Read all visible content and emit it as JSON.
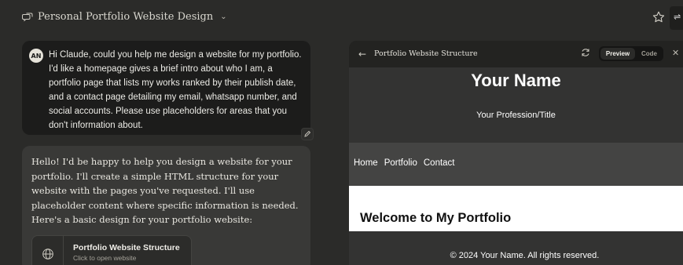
{
  "header": {
    "conversation_title": "Personal Portfolio Website Design",
    "icons": {
      "chat": "chat-bubbles-icon",
      "dropdown": "chevron-down-icon",
      "star": "star-icon",
      "settings": "sliders-icon"
    }
  },
  "user_message": {
    "avatar_initials": "AN",
    "text": "Hi Claude, could you help me design a website for my portfolio. I'd like a homepage gives a brief intro about who I am, a portfolio page that lists my works ranked by their publish date, and a contact page detailing my email, whatsapp number, and social accounts. Please use placeholders for areas that you don't information about."
  },
  "assistant_message": {
    "text": "Hello! I'd be happy to help you design a website for your portfolio. I'll create a simple HTML structure for your website with the pages you've requested. I'll use placeholder content where specific information is needed. Here's a basic design for your portfolio website:",
    "artifact": {
      "title": "Portfolio Website Structure",
      "subtitle": "Click to open website"
    }
  },
  "preview_panel": {
    "title": "Portfolio Website Structure",
    "preview_label": "Preview",
    "code_label": "Code",
    "site": {
      "name": "Your Name",
      "profession": "Your Profession/Title",
      "nav": [
        "Home",
        "Portfolio",
        "Contact"
      ],
      "welcome_heading": "Welcome to My Portfolio",
      "footer": "© 2024 Your Name. All rights reserved."
    }
  },
  "colors": {
    "background": "#2b2b29",
    "user_bubble": "#1c1c1b",
    "assistant_bubble": "#393937",
    "panel": "#1f1f1d"
  }
}
